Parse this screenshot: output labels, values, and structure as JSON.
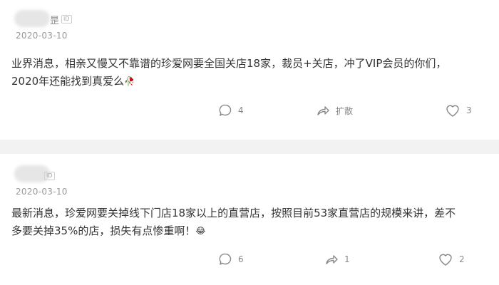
{
  "posts": [
    {
      "name_fragment": "昰",
      "id_badge": "ID",
      "date": "2020-03-10",
      "content_line1": "业界消息，相亲又慢又不靠谱的珍爱网要全国关店18家，裁员+关店，冲了VIP会员的你们，",
      "content_line2": "2020年还能找到真爱么",
      "emoji": "🥀",
      "actions": {
        "comments": "4",
        "share": "扩散",
        "likes": "3"
      }
    },
    {
      "name_fragment": "",
      "id_badge": "ID",
      "date": "2020-03-10",
      "content_line1": "最新消息，珍爱网要关掉线下门店18家以上的直营店，按照目前53家直营店的规模来讲，差不",
      "content_line2": "多要关掉35%的店，损失有点惨重啊！",
      "emoji": "😂",
      "actions": {
        "comments": "6",
        "share": "1",
        "likes": "2"
      }
    }
  ],
  "icons": {
    "comment": "comment-icon",
    "share": "share-arrow-icon",
    "like": "heart-icon"
  },
  "colors": {
    "background": "#f2f2f2",
    "card": "#ffffff",
    "meta_text": "#999999",
    "body_text": "#333333"
  }
}
